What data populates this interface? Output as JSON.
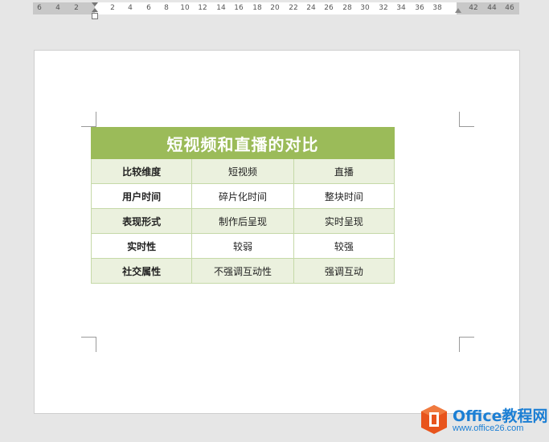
{
  "ruler": {
    "labels": [
      "6",
      "4",
      "2",
      "2",
      "4",
      "6",
      "8",
      "10",
      "12",
      "14",
      "16",
      "18",
      "20",
      "22",
      "24",
      "26",
      "28",
      "30",
      "32",
      "34",
      "36",
      "38",
      "42",
      "44",
      "46"
    ]
  },
  "table": {
    "title": "短视频和直播的对比",
    "rows": [
      [
        "比较维度",
        "短视频",
        "直播"
      ],
      [
        "用户时间",
        "碎片化时间",
        "整块时间"
      ],
      [
        "表现形式",
        "制作后呈现",
        "实时呈现"
      ],
      [
        "实时性",
        "较弱",
        "较强"
      ],
      [
        "社交属性",
        "不强调互动性",
        "强调互动"
      ]
    ]
  },
  "watermark": {
    "brand": "Office教程网",
    "url": "www.office26.com"
  },
  "colors": {
    "header": "#9bbb59",
    "band": "#ebf1de",
    "border": "#c5d9a8",
    "logo_orange": "#e8541c",
    "logo_blue": "#1c7fd4"
  }
}
